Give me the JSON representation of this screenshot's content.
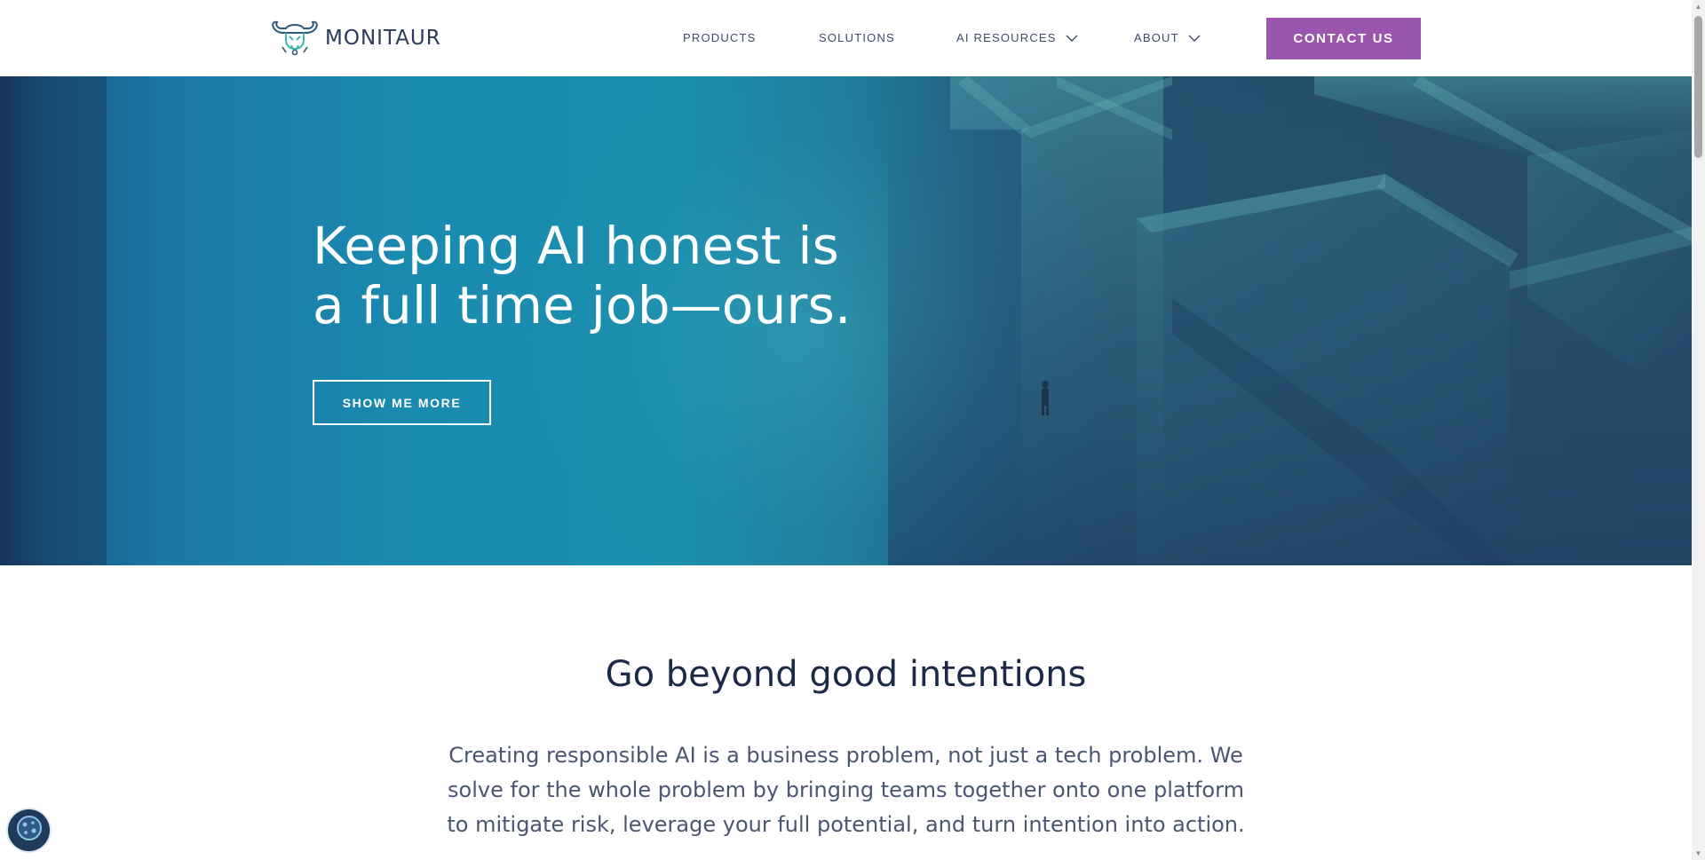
{
  "brand": {
    "name": "MONITAUR"
  },
  "nav": {
    "items": [
      {
        "label": "PRODUCTS",
        "has_dropdown": false
      },
      {
        "label": "SOLUTIONS",
        "has_dropdown": false
      },
      {
        "label": "AI RESOURCES",
        "has_dropdown": true
      },
      {
        "label": "ABOUT",
        "has_dropdown": true
      }
    ],
    "contact_label": "CONTACT US"
  },
  "hero": {
    "title_line1": "Keeping AI honest is",
    "title_line2": "a full time job—ours.",
    "cta_label": "SHOW ME MORE"
  },
  "intro": {
    "heading": "Go beyond good intentions",
    "body": "Creating responsible AI is a business problem, not just a tech problem. We solve for the whole problem by bringing teams together onto one platform to mitigate risk, leverage your full potential, and turn intention into action."
  },
  "colors": {
    "accent": "#9a56ad",
    "heading": "#1c2a48",
    "nav_text": "#3b4a66",
    "logo_teal": "#3fb6b2"
  },
  "icons": {
    "logo_mark": "minotaur-logo-icon",
    "dropdown": "chevron-down-icon",
    "cookie": "cookie-icon"
  }
}
